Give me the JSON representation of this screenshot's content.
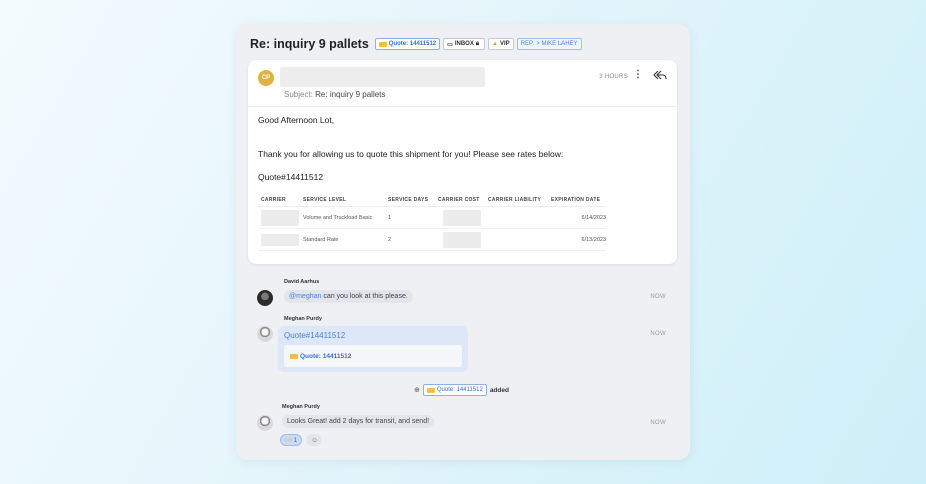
{
  "header": {
    "title": "Re: inquiry 9 pallets",
    "tags": {
      "quote": "Quote: 14411512",
      "inbox": "INBOX",
      "vip": "VIP",
      "rep": "REP: > MIKE LAHEY"
    }
  },
  "email": {
    "avatar_initials": "CP",
    "subject_label": "Subject:",
    "subject_value": "Re: inquiry 9 pallets",
    "time": "3 HOURS",
    "greeting": "Good Afternoon Lot,",
    "line1": "Thank you for allowing us to quote this shipment for you! Please see rates below:",
    "quote_ref": "Quote#14411512",
    "table": {
      "headers": [
        "CARRIER",
        "SERVICE LEVEL",
        "SERVICE DAYS",
        "CARRIER COST",
        "CARRIER LIABILITY",
        "EXPIRATION DATE"
      ],
      "rows": [
        {
          "service_level": "Volume and Truckload Basic",
          "service_days": "1",
          "expiration": "6/14/2023"
        },
        {
          "service_level": "Standard Rate",
          "service_days": "2",
          "expiration": "6/13/2023"
        }
      ]
    }
  },
  "comments": [
    {
      "name": "David Aarhus",
      "mention": "@meghan",
      "text": " can you look at this please.",
      "time": "NOW"
    },
    {
      "name": "Meghan Purdy",
      "link": "Quote#14411512",
      "attachment": "Quote: 14411512",
      "time": "NOW"
    },
    {
      "name": "Meghan Purdy",
      "text": "Looks Great! add 2 days for transit, and send!",
      "time": "NOW",
      "reaction_count": "1"
    }
  ],
  "activity": {
    "tag": "Quote: 14411512",
    "action": "added"
  },
  "colors": {
    "accent": "#4a7fe0",
    "avatar": "#e1b240"
  }
}
